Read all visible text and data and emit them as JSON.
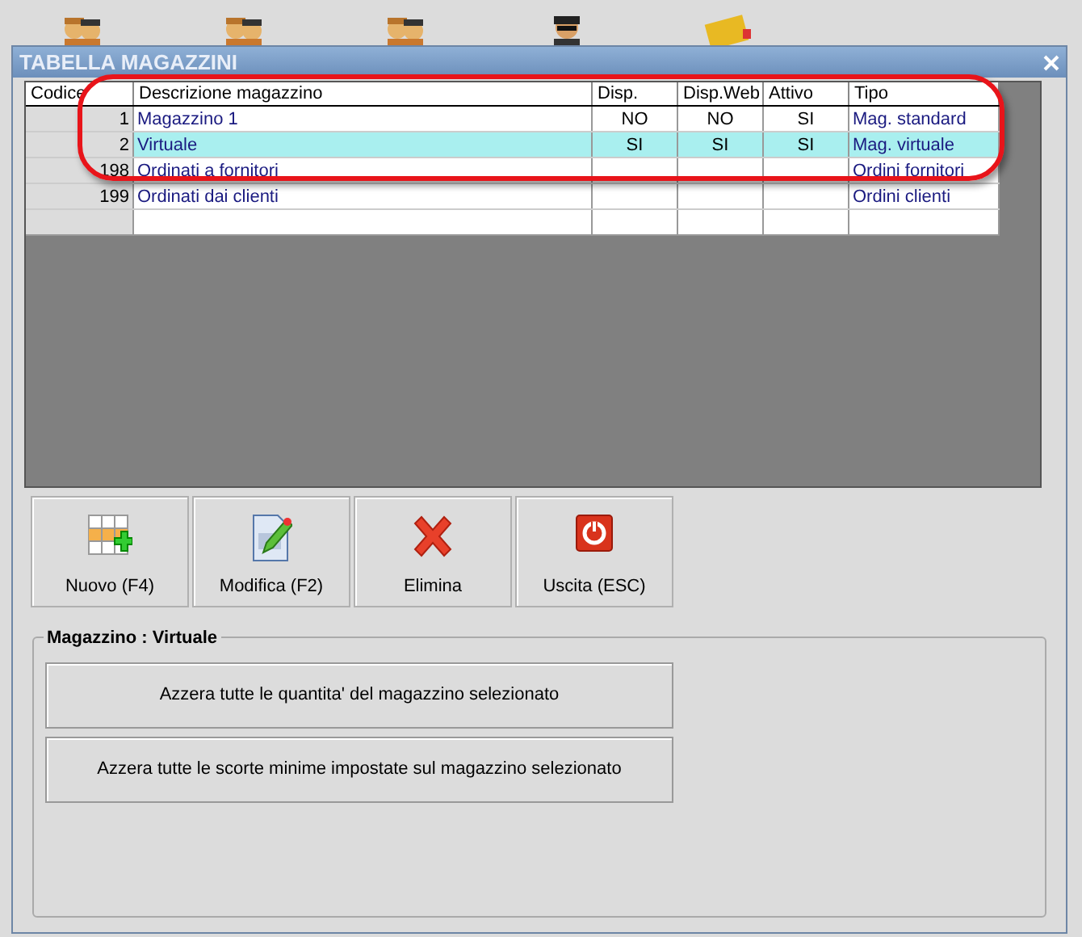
{
  "desktop_icons": [
    {
      "kind": "people"
    },
    {
      "kind": "people"
    },
    {
      "kind": "people"
    },
    {
      "kind": "person"
    },
    {
      "kind": "folder"
    }
  ],
  "window": {
    "title": "TABELLA MAGAZZINI"
  },
  "table": {
    "columns": [
      "Codice",
      "Descrizione magazzino",
      "Disp.",
      "Disp.Web",
      "Attivo",
      "Tipo"
    ],
    "rows": [
      {
        "cells": [
          "1",
          "Magazzino 1",
          "NO",
          "NO",
          "SI",
          "Mag. standard"
        ],
        "selected": false
      },
      {
        "cells": [
          "2",
          "Virtuale",
          "SI",
          "SI",
          "SI",
          "Mag. virtuale"
        ],
        "selected": true
      },
      {
        "cells": [
          "198",
          "Ordinati a fornitori",
          "",
          "",
          "",
          "Ordini fornitori"
        ],
        "selected": false
      },
      {
        "cells": [
          "199",
          "Ordinati dai clienti",
          "",
          "",
          "",
          "Ordini clienti"
        ],
        "selected": false
      }
    ]
  },
  "toolbar": [
    {
      "kind": "new",
      "label": "Nuovo (F4)"
    },
    {
      "kind": "edit",
      "label": "Modifica (F2)"
    },
    {
      "kind": "delete",
      "label": "Elimina"
    },
    {
      "kind": "exit",
      "label": "Uscita (ESC)"
    }
  ],
  "group": {
    "title": "Magazzino : Virtuale",
    "buttons": [
      "Azzera tutte le quantita' del magazzino selezionato",
      "Azzera tutte le scorte minime impostate sul magazzino selezionato"
    ]
  }
}
